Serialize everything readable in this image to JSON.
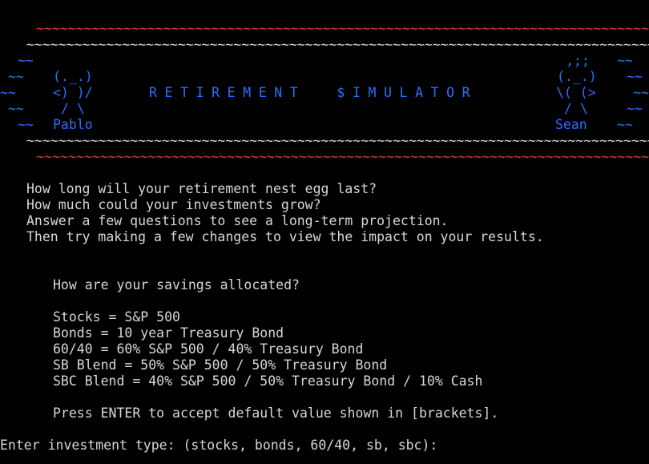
{
  "banner": {
    "top_red": "~~~~~~~~~~~~~~~~~~~~~~~~~~~~~~~~~~~~~~~~~~~~~~~~~~~~~~~~~~~~~~~~~~~~~~~~~~~~~~~",
    "top_white": "~~~~~~~~~~~~~~~~~~~~~~~~~~~~~~~~~~~~~~~~~~~~~~~~~~~~~~~~~~~~~~~~~~~~~~~~~~~~~~~~~",
    "bottom_white": "~~~~~~~~~~~~~~~~~~~~~~~~~~~~~~~~~~~~~~~~~~~~~~~~~~~~~~~~~~~~~~~~~~~~~~~~~~~~~~~~~",
    "bottom_red": "~~~~~~~~~~~~~~~~~~~~~~~~~~~~~~~~~~~~~~~~~~~~~~~~~~~~~~~~~~~~~~~~~~~~~~~~~~~~~~~",
    "title": "RETIREMENT  $IMULATOR",
    "left_art": {
      "waves1": "~~",
      "waves2": "~~",
      "waves3": "~~",
      "waves4": "~~",
      "waves5": "~~",
      "head": "(._.)",
      "arms": "<) )/",
      "legs": "/ \\",
      "name": "Pablo"
    },
    "right_art": {
      "waves1": "~~",
      "waves2": "~~",
      "waves3": "~~",
      "waves4": "~~",
      "waves5": "~~",
      "hair": ",;;",
      "head": "(._.)",
      "arms": "\\( (>",
      "legs": "/ \\",
      "name": "Sean"
    }
  },
  "intro": [
    "How long will your retirement nest egg last?",
    "How much could your investments grow?",
    "Answer a few questions to see a long-term projection.",
    "Then try making a few changes to view the impact on your results."
  ],
  "allocation": {
    "question": "How are your savings allocated?",
    "options": [
      "Stocks = S&P 500",
      "Bonds = 10 year Treasury Bond",
      "60/40 = 60% S&P 500 / 40% Treasury Bond",
      "SB Blend = 50% S&P 500 / 50% Treasury Bond",
      "SBC Blend = 40% S&P 500 / 50% Treasury Bond / 10% Cash"
    ],
    "hint": "Press ENTER to accept default value shown in [brackets]."
  },
  "prompt": {
    "label": "Enter investment type: (stocks, bonds, 60/40, sb, sbc):",
    "value": ""
  },
  "colors": {
    "background": "#000000",
    "red": "#e8383d",
    "blue": "#2b6fff",
    "text": "#d7d7d7"
  }
}
